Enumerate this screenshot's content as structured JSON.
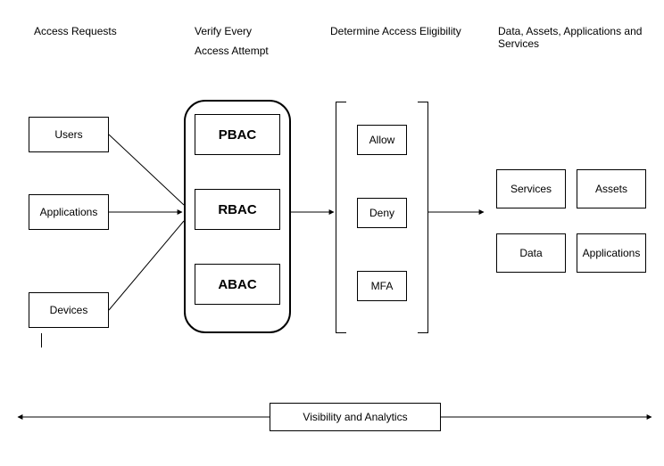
{
  "headers": {
    "col1": "Access Requests",
    "col2_line1": "Verify Every",
    "col2_line2": "Access Attempt",
    "col3": "Determine Access Eligibility",
    "col4": "Data, Assets, Applications and Services"
  },
  "requests": {
    "users": "Users",
    "applications": "Applications",
    "devices": "Devices"
  },
  "verify": {
    "pbac": "PBAC",
    "rbac": "RBAC",
    "abac": "ABAC"
  },
  "eligibility": {
    "allow": "Allow",
    "deny": "Deny",
    "mfa": "MFA"
  },
  "resources": {
    "services": "Services",
    "assets": "Assets",
    "data": "Data",
    "applications": "Applications"
  },
  "footer": "Visibility and Analytics"
}
